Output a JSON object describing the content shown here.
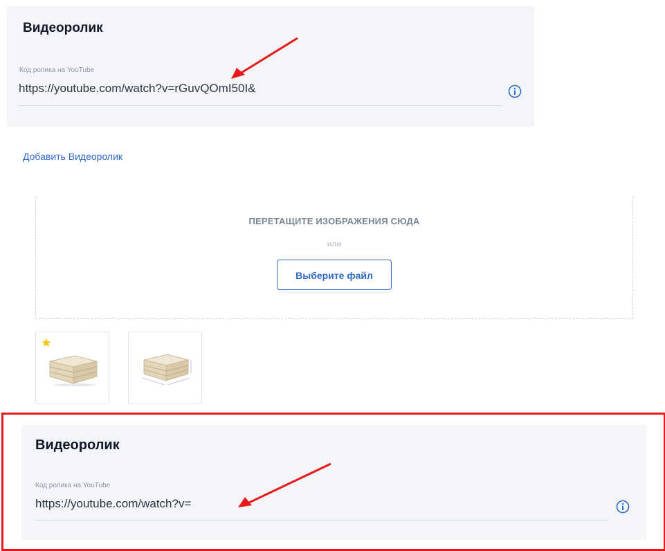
{
  "top_video": {
    "title": "Видеоролик",
    "field_label": "Код ролика на YouTube",
    "field_value": "https://youtube.com/watch?v=rGuvQOmI50I&"
  },
  "add_video_link": "Добавить Видеоролик",
  "upload": {
    "drop_text": "ПЕРЕТАЩИТЕ ИЗОБРАЖЕНИЯ СЮДА",
    "or_text": "или",
    "choose_file": "Выберите файл"
  },
  "thumbnails": [
    {
      "name": "crate-image-1",
      "main": true
    },
    {
      "name": "crate-image-2",
      "main": false
    }
  ],
  "bottom_video": {
    "title": "Видеоролик",
    "field_label": "Код ролика на YouTube",
    "field_value": "https://youtube.com/watch?v="
  },
  "colors": {
    "accent": "#2d6bc8",
    "highlight": "#e8191b",
    "star": "#f5c518"
  },
  "icons": [
    "info-icon",
    "star-icon",
    "arrow-annotation"
  ]
}
